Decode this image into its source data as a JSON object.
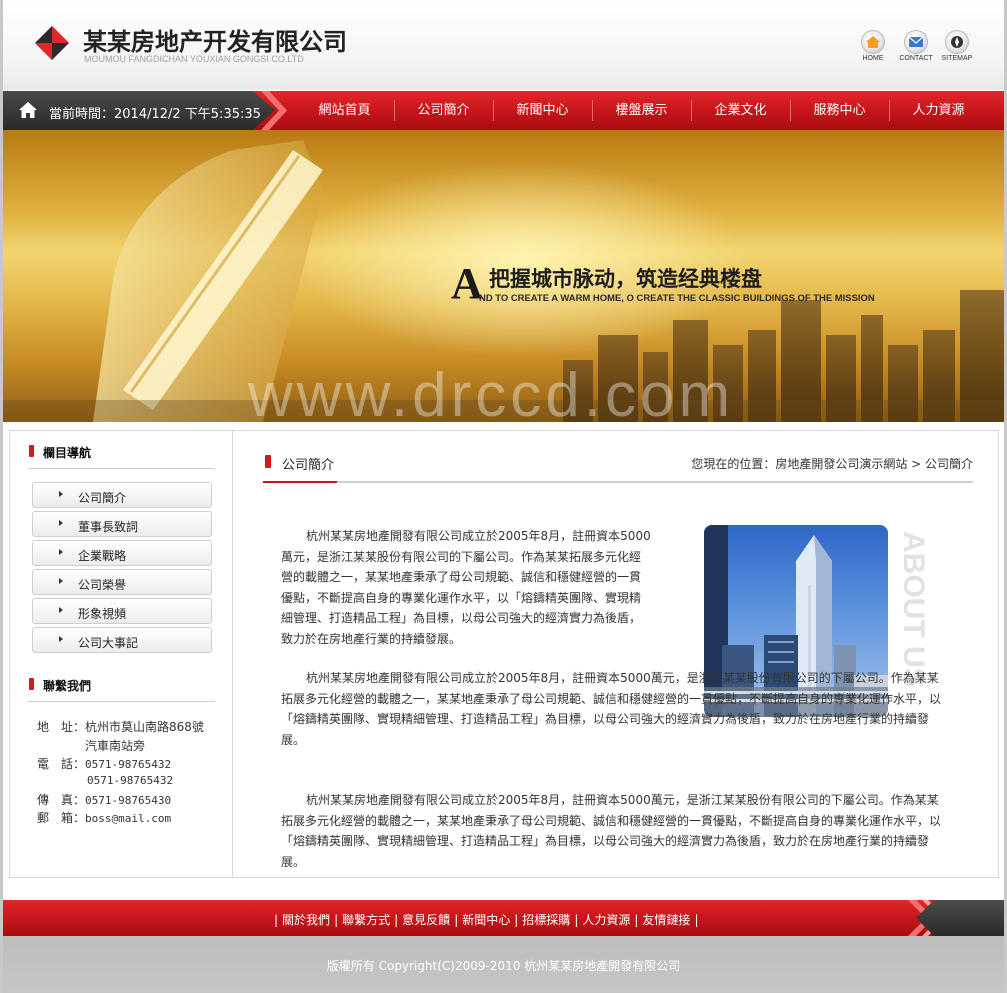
{
  "brand": {
    "name_cn": "某某房地产开发有限公司",
    "name_en": "MOUMOU FANGDICHAN YOUXIAN GONGSI CO.LTD"
  },
  "top_links": [
    {
      "label": "HOME",
      "icon": "home-icon"
    },
    {
      "label": "CONTACT",
      "icon": "mail-icon"
    },
    {
      "label": "SITEMAP",
      "icon": "sitemap-icon"
    }
  ],
  "status": {
    "time_text": "當前時間：2014/12/2 下午5:35:35"
  },
  "nav": {
    "items": [
      "網站首頁",
      "公司簡介",
      "新聞中心",
      "樓盤展示",
      "企業文化",
      "服務中心",
      "人力資源"
    ]
  },
  "banner": {
    "slogan_initial": "A",
    "slogan_cn": "把握城市脉动，筑造经典楼盘",
    "slogan_en": "ND TO CREATE A WARM HOME,  O CREATE THE CLASSIC BUILDINGS OF THE MISSION",
    "watermark": "www.drccd.com"
  },
  "sidebar": {
    "nav_title": "欄目導航",
    "nav_items": [
      "公司簡介",
      "董事長致詞",
      "企業戰略",
      "公司榮譽",
      "形象視頻",
      "公司大事記"
    ],
    "contact_title": "聯繫我們",
    "contact": {
      "address_label": "地　址：",
      "address_line1": "杭州市莫山南路868號",
      "address_line2": "汽車南站旁",
      "phone_label": "電　話：",
      "phone1": "0571-98765432",
      "phone2": "0571-98765432",
      "fax_label": "傳　真：",
      "fax": "0571-98765430",
      "email_label": "郵　箱：",
      "email": "boss@mail.com"
    }
  },
  "main": {
    "title": "公司簡介",
    "breadcrumb": "您現在的位置：房地產開發公司演示網站 > 公司簡介",
    "side_text": "ABOUT US",
    "paragraphs": [
      "杭州某某房地產開發有限公司成立於2005年8月，註冊資本5000萬元，是浙江某某股份有限公司的下屬公司。作為某某拓展多元化經營的載體之一，某某地產秉承了母公司規範、誠信和穩健經營的一貫優點，不斷提高自身的專業化運作水平，以「熔鑄精英團隊、實現精細管理、打造精品工程」為目標，以母公司強大的經濟實力為後盾，致力於在房地產行業的持續發展。",
      "杭州某某房地產開發有限公司成立於2005年8月，註冊資本5000萬元，是浙江某某股份有限公司的下屬公司。作為某某拓展多元化經營的載體之一，某某地產秉承了母公司規範、誠信和穩健經營的一貫優點，不斷提高自身的專業化運作水平，以「熔鑄精英團隊、實現精細管理、打造精品工程」為目標，以母公司強大的經濟實力為後盾，致力於在房地產行業的持續發展。",
      "杭州某某房地產開發有限公司成立於2005年8月，註冊資本5000萬元，是浙江某某股份有限公司的下屬公司。作為某某拓展多元化經營的載體之一，某某地產秉承了母公司規範、誠信和穩健經營的一貫優點，不斷提高自身的專業化運作水平，以「熔鑄精英團隊、實現精細管理、打造精品工程」為目標，以母公司強大的經濟實力為後盾，致力於在房地產行業的持續發展。"
    ]
  },
  "footer": {
    "links": [
      "關於我們",
      "聯繫方式",
      "意見反饋",
      "新聞中心",
      "招標採購",
      "人力資源",
      "友情鏈接"
    ],
    "separator": "|",
    "copyright": "版權所有 Copyright(C)2009-2010 杭州某某房地產開發有限公司"
  },
  "colors": {
    "accent_red": "#c8161b",
    "dark_gray": "#333333",
    "gold": "#e0b040"
  }
}
